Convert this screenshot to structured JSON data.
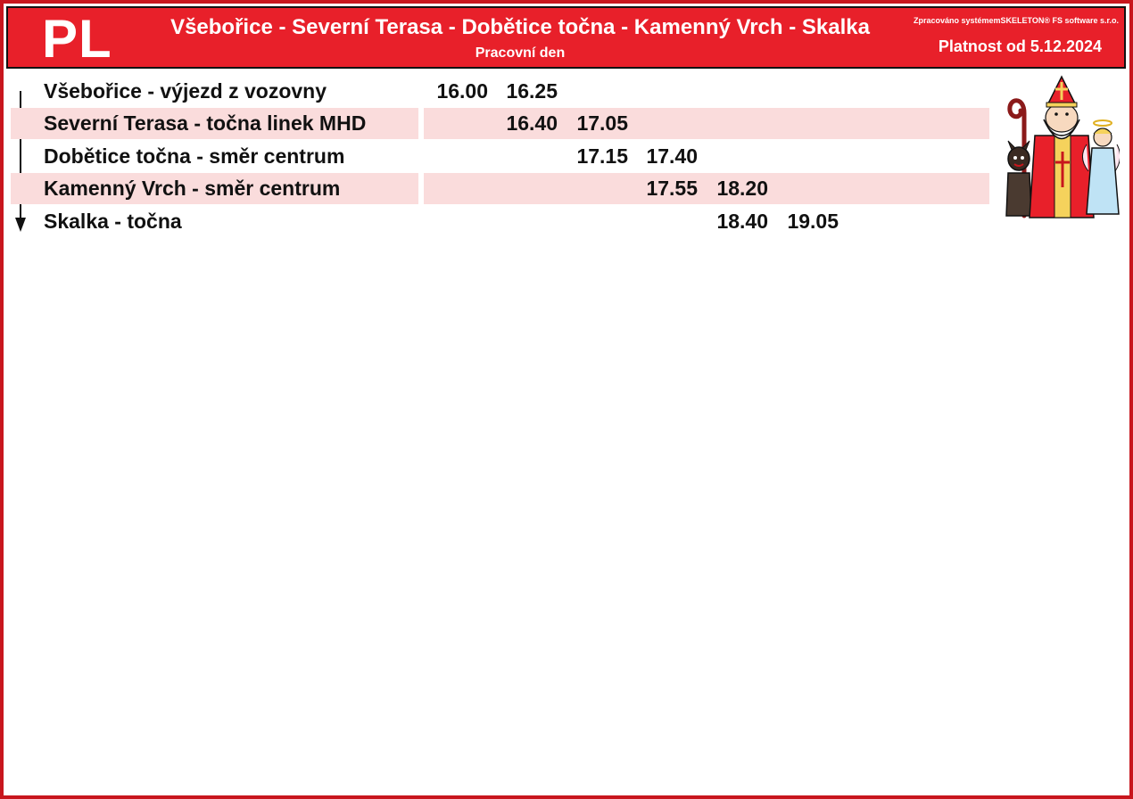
{
  "header": {
    "line_code": "PL",
    "route_title": "Všebořice - Severní Terasa - Dobětice točna - Kamenný Vrch - Skalka",
    "day_type": "Pracovní den",
    "processed_by": "Zpracováno systémemSKELETON® FS software s.r.o.",
    "validity": "Platnost od 5.12.2024"
  },
  "colors": {
    "accent": "#e8202a",
    "frame": "#c8161d",
    "row_shade": "#fadcdc"
  },
  "illustration_icon": "st-nicholas-devil-angel-illustration",
  "timetable": {
    "stops": [
      {
        "name": "Všebořice - výjezd z vozovny",
        "times": [
          "16.00",
          "16.25"
        ]
      },
      {
        "name": "Severní Terasa - točna linek MHD",
        "times": [
          "16.40",
          "17.05"
        ]
      },
      {
        "name": "Dobětice točna - směr centrum",
        "times": [
          "17.15",
          "17.40"
        ]
      },
      {
        "name": "Kamenný Vrch - směr centrum",
        "times": [
          "17.55",
          "18.20"
        ]
      },
      {
        "name": "Skalka - točna",
        "times": [
          "18.40",
          "19.05"
        ]
      }
    ]
  }
}
